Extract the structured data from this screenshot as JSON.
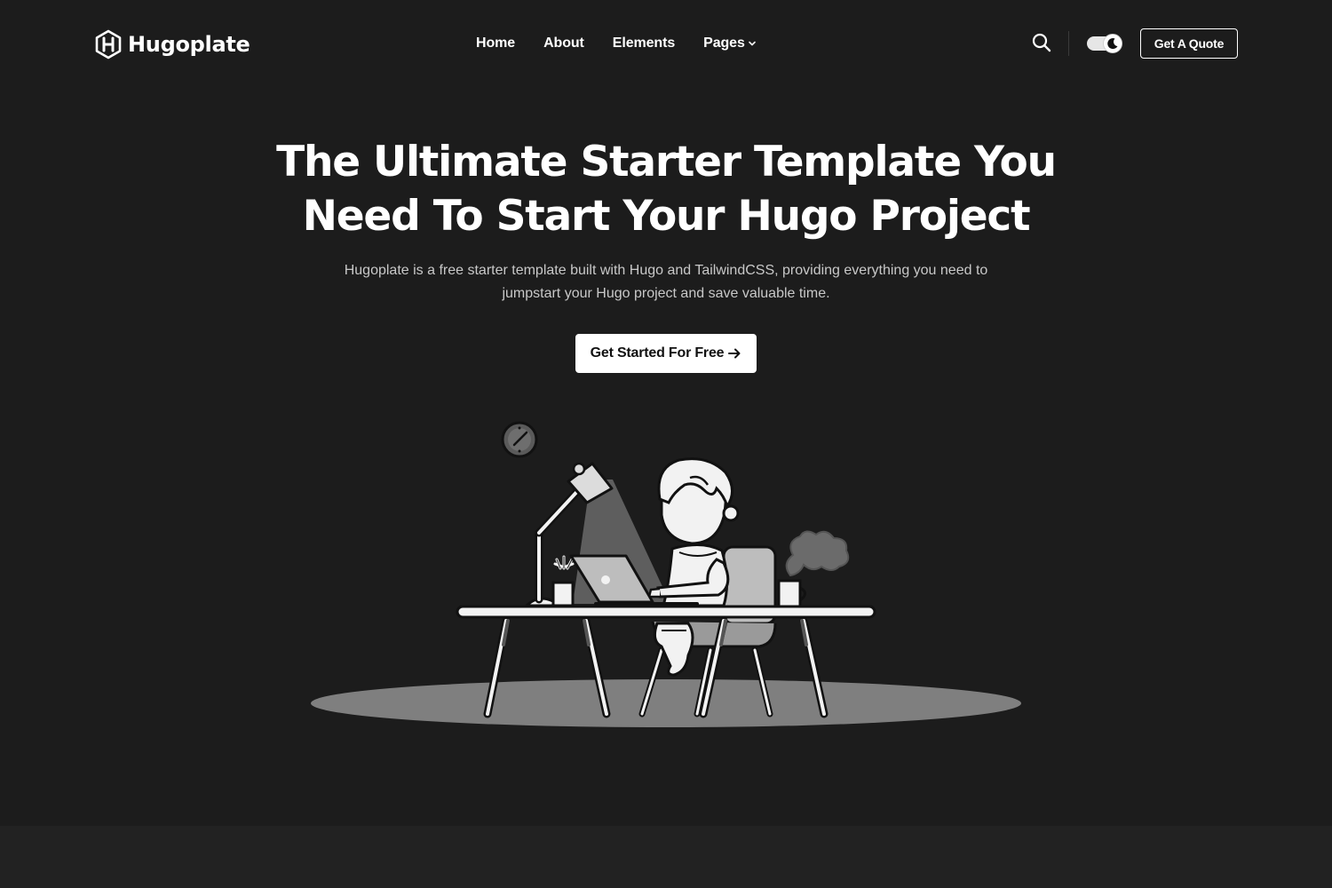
{
  "brand": {
    "name": "Hugoplate",
    "logo_icon": "hexagon-h-logo-icon"
  },
  "nav": {
    "items": [
      {
        "label": "Home"
      },
      {
        "label": "About"
      },
      {
        "label": "Elements"
      },
      {
        "label": "Pages",
        "has_dropdown": true
      }
    ]
  },
  "header": {
    "search_icon": "search-icon",
    "theme_toggle_icon": "moon-icon",
    "quote_button_label": "Get A Quote"
  },
  "hero": {
    "title": "The Ultimate Starter Template You Need To Start Your Hugo Project",
    "description": "Hugoplate is a free starter template built with Hugo and TailwindCSS, providing everything you need to jumpstart your Hugo project and save valuable time.",
    "cta_label": "Get Started For Free",
    "cta_icon": "arrow-right-icon",
    "illustration": "person-working-at-desk-illustration"
  },
  "colors": {
    "background": "#1c1c1c",
    "text": "#ffffff",
    "muted_text": "#c8c8c8",
    "button_bg": "#ffffff",
    "section_band": "#222222"
  }
}
